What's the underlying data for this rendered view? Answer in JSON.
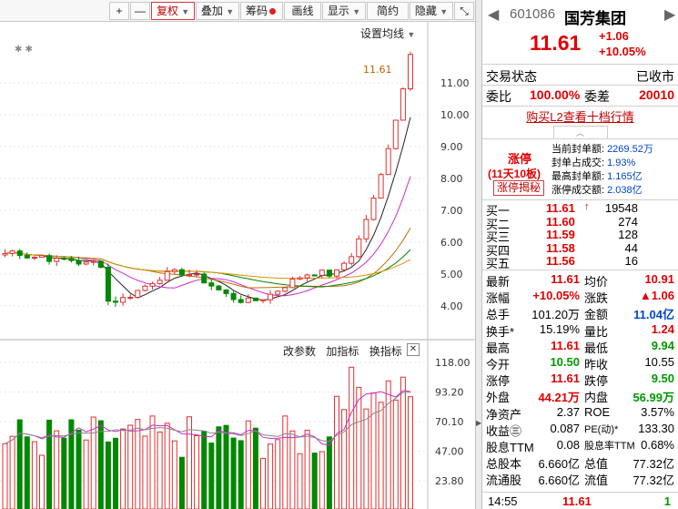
{
  "toolbar": {
    "plus": "+",
    "minus": "—",
    "fuquan": "复权",
    "diejia": "叠加",
    "chouma": "筹码",
    "huaxian": "画线",
    "xianshi": "显示",
    "jianyue": "简约",
    "yincang": "隐藏"
  },
  "main_chart": {
    "setting_ma": "设置均线",
    "last_price_label": "11.61",
    "y_ticks": [
      "11.00",
      "10.00",
      "9.00",
      "8.00",
      "7.00",
      "6.00",
      "5.00",
      "4.00"
    ],
    "star_markers": "✱ ✱"
  },
  "volume": {
    "change_params": "改参数",
    "add_indicator": "加指标",
    "switch_indicator": "换指标",
    "close": "✕",
    "y_ticks": [
      "118.00",
      "93.20",
      "70.10",
      "47.00",
      "23.80"
    ]
  },
  "quote": {
    "code": "601086",
    "name": "国芳集团",
    "price": "11.61",
    "change": "+1.06",
    "change_pct": "+10.05%",
    "trade_status_label": "交易状态",
    "trade_status": "已收市",
    "weibi_label": "委比",
    "weibi": "100.00%",
    "weicha_label": "委差",
    "weicha": "20010",
    "l2_link": "购买L2查看十档行情",
    "limit_up_title": "涨停",
    "limit_up_days": "(11天10板)",
    "limit_up_btn": "涨停揭秘",
    "seal_rows": [
      {
        "label": "当前封单额:",
        "value": "2269.52万"
      },
      {
        "label": "封单占成交:",
        "value": "1.93%"
      },
      {
        "label": "最高封单额:",
        "value": "1.165亿"
      },
      {
        "label": "涨停成交额:",
        "value": "2.038亿"
      }
    ],
    "bids": [
      {
        "label": "买一",
        "price": "11.61",
        "arrow": "↑",
        "vol": "19548"
      },
      {
        "label": "买二",
        "price": "11.60",
        "arrow": "",
        "vol": "274"
      },
      {
        "label": "买三",
        "price": "11.59",
        "arrow": "",
        "vol": "128"
      },
      {
        "label": "买四",
        "price": "11.58",
        "arrow": "",
        "vol": "44"
      },
      {
        "label": "买五",
        "price": "11.56",
        "arrow": "",
        "vol": "16"
      }
    ],
    "stats": [
      {
        "l1": "最新",
        "v1": "11.61",
        "c1": "red",
        "l2": "均价",
        "v2": "10.91",
        "c2": "red"
      },
      {
        "l1": "涨幅",
        "v1": "+10.05%",
        "c1": "red",
        "l2": "涨跌",
        "v2": "▲1.06",
        "c2": "red"
      },
      {
        "l1": "总手",
        "v1": "101.20万",
        "c1": "",
        "l2": "金额",
        "v2": "11.04亿",
        "c2": "blue"
      },
      {
        "l1": "换手*",
        "v1": "15.19%",
        "c1": "",
        "l2": "量比",
        "v2": "1.24",
        "c2": "red"
      },
      {
        "l1": "最高",
        "v1": "11.61",
        "c1": "red",
        "l2": "最低",
        "v2": "9.94",
        "c2": "green"
      },
      {
        "l1": "今开",
        "v1": "10.50",
        "c1": "green",
        "l2": "昨收",
        "v2": "10.55",
        "c2": ""
      },
      {
        "l1": "涨停",
        "v1": "11.61",
        "c1": "red",
        "l2": "跌停",
        "v2": "9.50",
        "c2": "green"
      },
      {
        "l1": "外盘",
        "v1": "44.21万",
        "c1": "red",
        "l2": "内盘",
        "v2": "56.99万",
        "c2": "green"
      },
      {
        "l1": "净资产",
        "v1": "2.37",
        "c1": "",
        "l2": "ROE",
        "v2": "3.57%",
        "c2": ""
      },
      {
        "l1": "收益㊂",
        "v1": "0.087",
        "c1": "",
        "l2": "PE(动)*",
        "v2": "133.30",
        "c2": ""
      },
      {
        "l1": "股息TTM",
        "v1": "0.08",
        "c1": "",
        "l2": "股息率TTM",
        "v2": "0.68%",
        "c2": ""
      },
      {
        "l1": "总股本",
        "v1": "6.660亿",
        "c1": "",
        "l2": "总值",
        "v2": "77.32亿",
        "c2": ""
      },
      {
        "l1": "流通股",
        "v1": "6.660亿",
        "c1": "",
        "l2": "流值",
        "v2": "77.32亿",
        "c2": ""
      }
    ],
    "tick": {
      "time": "14:55",
      "price": "11.61",
      "vol": "1"
    }
  }
}
